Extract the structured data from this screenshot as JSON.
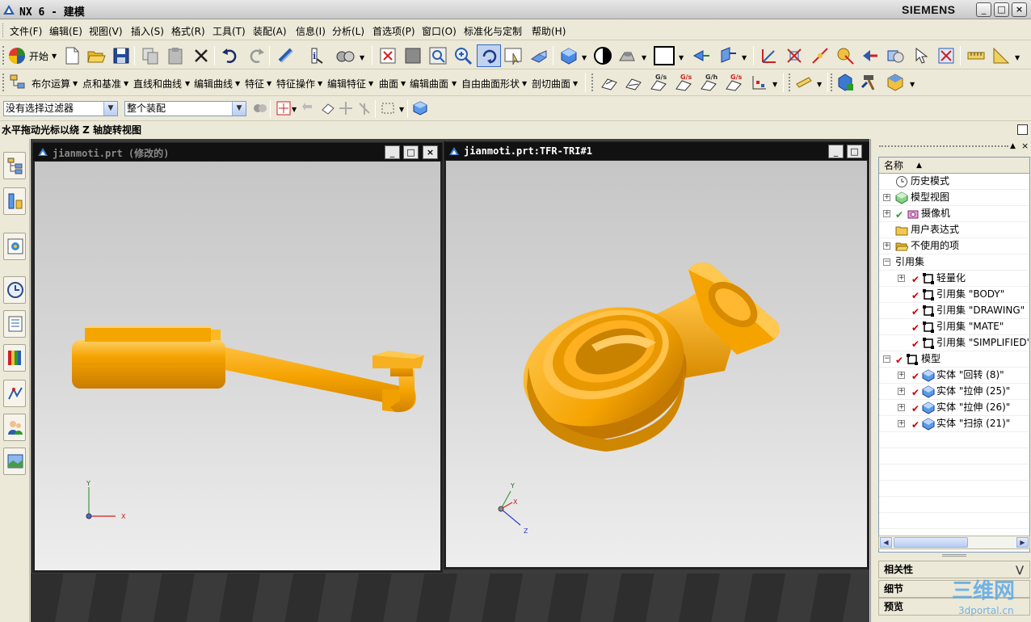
{
  "titlebar": {
    "title": "NX 6 - 建模",
    "brand": "SIEMENS",
    "min": "_",
    "max": "□",
    "close": "×"
  },
  "menu": [
    "文件(F)",
    "编辑(E)",
    "视图(V)",
    "插入(S)",
    "格式(R)",
    "工具(T)",
    "装配(A)",
    "信息(I)",
    "分析(L)",
    "首选项(P)",
    "窗口(O)",
    "标准化与定制",
    "帮助(H)"
  ],
  "toolbar1": {
    "start_label": "开始"
  },
  "toolbar2": {
    "groups": [
      "布尔运算",
      "点和基准",
      "直线和曲线",
      "编辑曲线",
      "特征",
      "特征操作",
      "编辑特征",
      "曲面",
      "编辑曲面",
      "自由曲面形状",
      "剖切曲面"
    ]
  },
  "selection": {
    "filter_value": "没有选择过滤器",
    "scope_value": "整个装配"
  },
  "status": {
    "cue": "水平拖动光标以绕 Z 轴旋转视图"
  },
  "viewports": {
    "left": {
      "title": "jianmoti.prt (修改的)",
      "axis_x": "X",
      "axis_y": "Y"
    },
    "right": {
      "title": "jianmoti.prt:TFR-TRI#1",
      "axis_x": "X",
      "axis_y": "Y",
      "axis_z": "Z"
    },
    "min": "_",
    "max": "□",
    "close": "×"
  },
  "navigator": {
    "header": "名称",
    "nodes": [
      {
        "label": "历史模式"
      },
      {
        "label": "模型视图"
      },
      {
        "label": "摄像机"
      },
      {
        "label": "用户表达式"
      },
      {
        "label": "不使用的项"
      },
      {
        "label": "引用集"
      },
      {
        "label": "轻量化"
      },
      {
        "label": "引用集 \"BODY\""
      },
      {
        "label": "引用集 \"DRAWING\""
      },
      {
        "label": "引用集 \"MATE\""
      },
      {
        "label": "引用集 \"SIMPLIFIED\""
      },
      {
        "label": "模型"
      },
      {
        "label": "实体 \"回转 (8)\""
      },
      {
        "label": "实体 \"拉伸 (25)\""
      },
      {
        "label": "实体 \"拉伸 (26)\""
      },
      {
        "label": "实体 \"扫掠 (21)\""
      }
    ],
    "sections": [
      "相关性",
      "细节",
      "预览"
    ]
  },
  "watermark": {
    "text": "三维网",
    "url": "3dportal.cn"
  },
  "colors": {
    "part": "#f5a300",
    "part_dark": "#c97d00",
    "bg_top": "#c6c6c6",
    "bg_bottom": "#eeeeee",
    "check": "#cc0000"
  }
}
